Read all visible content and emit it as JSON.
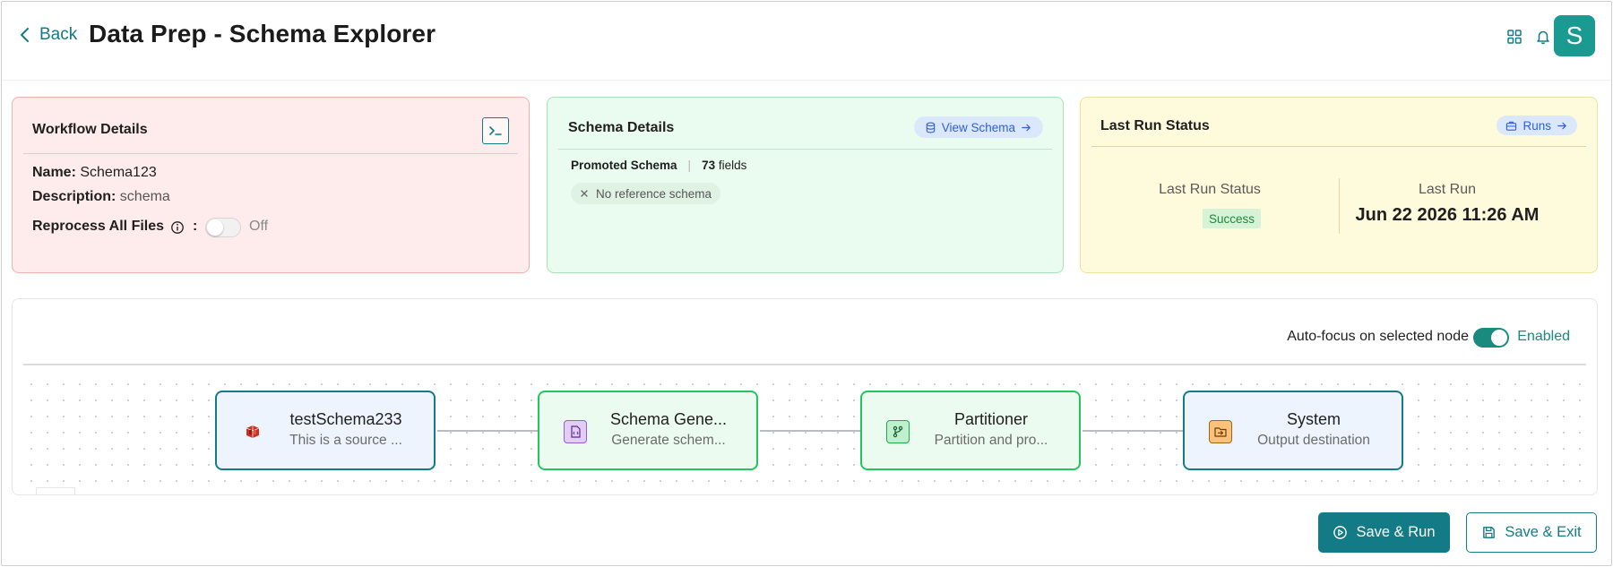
{
  "header": {
    "back_label": "Back",
    "title": "Data Prep - Schema Explorer",
    "avatar_initial": "S"
  },
  "workflow_card": {
    "title": "Workflow Details",
    "name_label": "Name:",
    "name_value": "Schema123",
    "description_label": "Description:",
    "description_value": "schema",
    "reprocess_label": "Reprocess All Files",
    "reprocess_colon": ":",
    "reprocess_state": "Off"
  },
  "schema_card": {
    "title": "Schema Details",
    "view_schema_label": "View Schema",
    "promoted_label": "Promoted Schema",
    "separator": "|",
    "field_count": "73",
    "fields_label": "fields",
    "reference_chip": "No reference schema"
  },
  "last_run_card": {
    "title": "Last Run Status",
    "runs_label": "Runs",
    "status_label": "Last Run Status",
    "status_value": "Success",
    "last_run_label": "Last Run",
    "last_run_value": "Jun 22 2026 11:26 AM"
  },
  "canvas": {
    "autofocus_label": "Auto-focus on selected node",
    "autofocus_state": "Enabled",
    "nodes": [
      {
        "title": "testSchema233",
        "subtitle": "This is a source ...",
        "icon": "source-icon"
      },
      {
        "title": "Schema Gene...",
        "subtitle": "Generate schem...",
        "icon": "schema-file-icon"
      },
      {
        "title": "Partitioner",
        "subtitle": "Partition and pro...",
        "icon": "branch-icon"
      },
      {
        "title": "System",
        "subtitle": "Output destination",
        "icon": "output-folder-icon"
      }
    ]
  },
  "actions": {
    "save_run_label": "Save & Run",
    "save_exit_label": "Save & Exit"
  },
  "colors": {
    "brand_teal": "#137b85",
    "workflow_bg": "#fdeceb",
    "schema_bg": "#eafbef",
    "lastrun_bg": "#fefbdc",
    "success_text": "#23863a",
    "node_green_border": "#22c55e"
  }
}
